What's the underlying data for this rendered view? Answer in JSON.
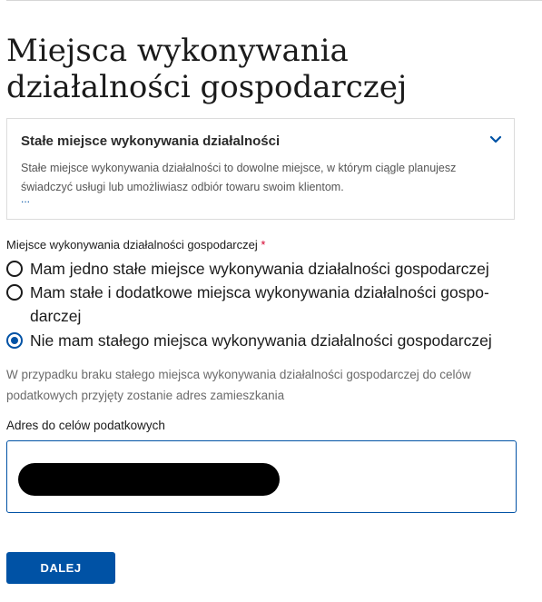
{
  "page": {
    "title": "Miejsca wykonywania działalności gospodarczej"
  },
  "info_box": {
    "title": "Stałe miejsce wykonywania działalności",
    "text": "Stałe miejsce wykonywania działalności to dowolne miejsce, w którym ciągle planujesz świadczyć usługi lub umożliwiasz odbiór towaru swoim klientom.",
    "more_link": "...",
    "icon": "chevron-down-icon",
    "expanded": false
  },
  "location_field": {
    "label": "Miejsce wykonywania działalności gospodarczej",
    "required_marker": "*",
    "options": [
      {
        "label": "Mam jedno stałe miejsce wykonywania działalności gospodarczej",
        "checked": false
      },
      {
        "label": "Mam stałe i dodatkowe miejsca wykonywania działalności gospo-darczej",
        "checked": false
      },
      {
        "label": "Nie mam stałego miejsca wykonywania działalności gospodarczej",
        "checked": true
      }
    ],
    "hint": "W przypadku braku stałego miejsca wykonywania działalności gospodarczej do celów podatkowych przyjęty zostanie adres zamieszkania"
  },
  "address_field": {
    "label": "Adres do celów podatkowych",
    "value_redacted": true
  },
  "actions": {
    "next_label": "DALEJ"
  },
  "colors": {
    "accent": "#0052a5",
    "required": "#d4002c",
    "text": "#1b1b1b",
    "muted": "#6b6b6b"
  }
}
